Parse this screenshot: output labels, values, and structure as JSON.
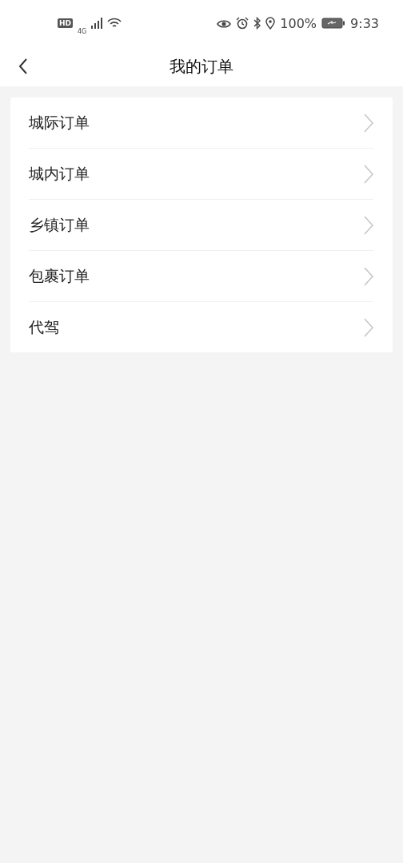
{
  "status_bar": {
    "hd_badge": "HD",
    "network": "4G",
    "battery_percent": "100%",
    "time": "9:33"
  },
  "header": {
    "title": "我的订单"
  },
  "menu": [
    {
      "label": "城际订单"
    },
    {
      "label": "城内订单"
    },
    {
      "label": "乡镇订单"
    },
    {
      "label": "包裹订单"
    },
    {
      "label": "代驾"
    }
  ]
}
